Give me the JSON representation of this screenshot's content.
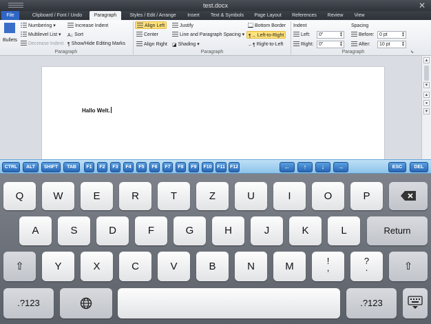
{
  "window": {
    "title": "test.docx"
  },
  "tabs": [
    "File",
    "Clipboard / Font / Undo",
    "Paragraph",
    "Styles / Edit / Arrange",
    "Insert",
    "Text & Symbols",
    "Page Layout",
    "References",
    "Review",
    "View"
  ],
  "ribbon": {
    "bullets": "Bullets",
    "numbering": "Numbering",
    "multilevel": "Multilevel List",
    "decrease_indent": "Decrease Indent",
    "increase_indent": "Increase Indent",
    "sort": "Sort",
    "show_hide": "Show/Hide Editing Marks",
    "align_left": "Align Left",
    "center": "Center",
    "align_right": "Align Right",
    "justify": "Justify",
    "line_spacing": "Line and Paragraph Spacing",
    "shading": "Shading",
    "bottom_border": "Bottom Border",
    "ltr": "Left-to-Right",
    "rtl": "Right-to-Left",
    "indent_title": "Indent",
    "indent_left_label": "Left:",
    "indent_left_value": "0\"",
    "indent_right_label": "Right:",
    "indent_right_value": "0\"",
    "spacing_title": "Spacing",
    "spacing_before_label": "Before:",
    "spacing_before_value": "0 pt",
    "spacing_after_label": "After:",
    "spacing_after_value": "10 pt",
    "group_label": "Paragraph"
  },
  "document": {
    "text": "Hallo Welt."
  },
  "fnkeys": [
    "CTRL",
    "ALT",
    "SHIFT",
    "TAB",
    "F1",
    "F2",
    "F3",
    "F4",
    "F5",
    "F6",
    "F7",
    "F8",
    "F9",
    "F10",
    "F11",
    "F12"
  ],
  "arrows": [
    "←",
    "↑",
    "↓",
    "→"
  ],
  "fnkeys_right": [
    "ESC",
    "DEL"
  ],
  "keyboard": {
    "row1": [
      "Q",
      "W",
      "E",
      "R",
      "T",
      "Z",
      "U",
      "I",
      "O",
      "P"
    ],
    "row2": [
      "A",
      "S",
      "D",
      "F",
      "G",
      "H",
      "J",
      "K",
      "L"
    ],
    "return": "Return",
    "row3": [
      "Y",
      "X",
      "C",
      "V",
      "B",
      "N",
      "M"
    ],
    "excl": [
      "!",
      ","
    ],
    "quest": [
      "?",
      "."
    ],
    "numbers": ".?123"
  }
}
